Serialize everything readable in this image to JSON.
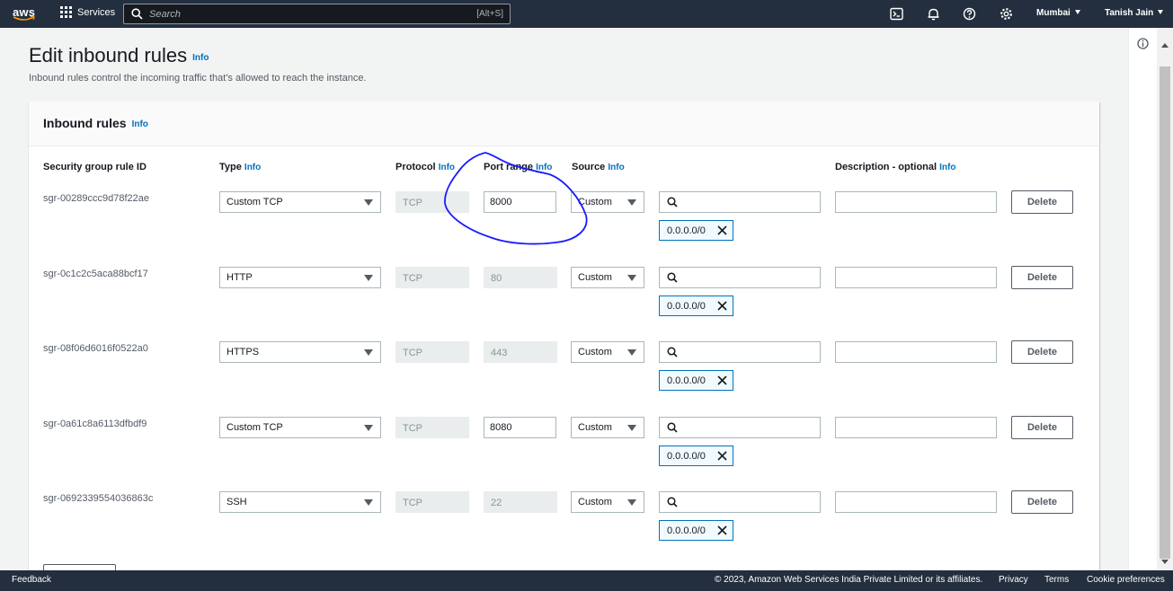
{
  "topnav": {
    "logo_text": "aws",
    "services_label": "Services",
    "search_placeholder": "Search",
    "search_shortcut": "[Alt+S]",
    "region": "Mumbai",
    "user": "Tanish Jain"
  },
  "page": {
    "title": "Edit inbound rules",
    "title_info": "Info",
    "description": "Inbound rules control the incoming traffic that's allowed to reach the instance."
  },
  "panel": {
    "title": "Inbound rules",
    "title_info": "Info",
    "columns": {
      "rule_id": "Security group rule ID",
      "type": "Type",
      "type_info": "Info",
      "protocol": "Protocol",
      "protocol_info": "Info",
      "port_range": "Port range",
      "port_info": "Info",
      "source": "Source",
      "source_info": "Info",
      "description": "Description - optional",
      "description_info": "Info"
    },
    "delete_label": "Delete",
    "rules": [
      {
        "id": "sgr-00289ccc9d78f22ae",
        "type": "Custom TCP",
        "protocol": "TCP",
        "port": "8000",
        "port_editable": true,
        "source": "Custom",
        "cidr": "0.0.0.0/0"
      },
      {
        "id": "sgr-0c1c2c5aca88bcf17",
        "type": "HTTP",
        "protocol": "TCP",
        "port": "80",
        "port_editable": false,
        "source": "Custom",
        "cidr": "0.0.0.0/0"
      },
      {
        "id": "sgr-08f06d6016f0522a0",
        "type": "HTTPS",
        "protocol": "TCP",
        "port": "443",
        "port_editable": false,
        "source": "Custom",
        "cidr": "0.0.0.0/0"
      },
      {
        "id": "sgr-0a61c8a6113dfbdf9",
        "type": "Custom TCP",
        "protocol": "TCP",
        "port": "8080",
        "port_editable": true,
        "source": "Custom",
        "cidr": "0.0.0.0/0"
      },
      {
        "id": "sgr-0692339554036863c",
        "type": "SSH",
        "protocol": "TCP",
        "port": "22",
        "port_editable": false,
        "source": "Custom",
        "cidr": "0.0.0.0/0"
      }
    ]
  },
  "footer": {
    "feedback": "Feedback",
    "copyright": "© 2023, Amazon Web Services India Private Limited or its affiliates.",
    "privacy": "Privacy",
    "terms": "Terms",
    "cookies": "Cookie preferences"
  },
  "colors": {
    "nav_bg": "#232f3e",
    "link": "#0073bb",
    "annotation": "#1a1aff"
  }
}
